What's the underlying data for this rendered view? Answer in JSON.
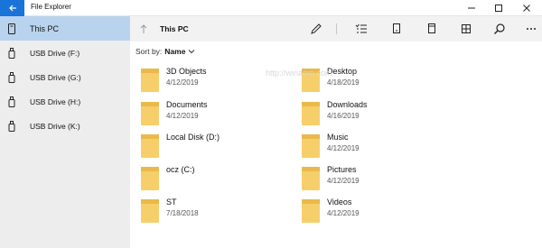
{
  "window": {
    "title": "File Explorer",
    "accent": "#1a73d9",
    "icons": [
      "back-arrow-icon",
      "minimize-icon",
      "maximize-icon",
      "close-icon"
    ]
  },
  "sidebar": {
    "items": [
      {
        "label": "This PC",
        "icon": "pc-icon",
        "active": true
      },
      {
        "label": "USB Drive (F:)",
        "icon": "usb-drive-icon",
        "active": false
      },
      {
        "label": "USB Drive (G:)",
        "icon": "usb-drive-icon",
        "active": false
      },
      {
        "label": "USB Drive (H:)",
        "icon": "usb-drive-icon",
        "active": false
      },
      {
        "label": "USB Drive (K:)",
        "icon": "usb-drive-icon",
        "active": false
      }
    ],
    "active_color": "#b9d3ee"
  },
  "toolbar": {
    "location": "This PC",
    "icons": [
      "up-arrow-icon",
      "rename-pencil-icon",
      "select-list-icon",
      "copy-icon",
      "cut-icon",
      "view-grid-icon",
      "search-icon",
      "more-icon"
    ]
  },
  "sort": {
    "label": "Sort by:",
    "value": "Name"
  },
  "files": [
    {
      "name": "3D Objects",
      "date": "4/12/2019"
    },
    {
      "name": "Documents",
      "date": "4/12/2019"
    },
    {
      "name": "Local Disk (D:)",
      "date": ""
    },
    {
      "name": "ocz (C:)",
      "date": ""
    },
    {
      "name": "ST",
      "date": "7/18/2018"
    },
    {
      "name": "Desktop",
      "date": "4/18/2019"
    },
    {
      "name": "Downloads",
      "date": "4/16/2019"
    },
    {
      "name": "Music",
      "date": "4/12/2019"
    },
    {
      "name": "Pictures",
      "date": "4/12/2019"
    },
    {
      "name": "Videos",
      "date": "4/12/2019"
    }
  ],
  "folder_color": "#f6cf6a",
  "watermark": "http://winaero.com"
}
